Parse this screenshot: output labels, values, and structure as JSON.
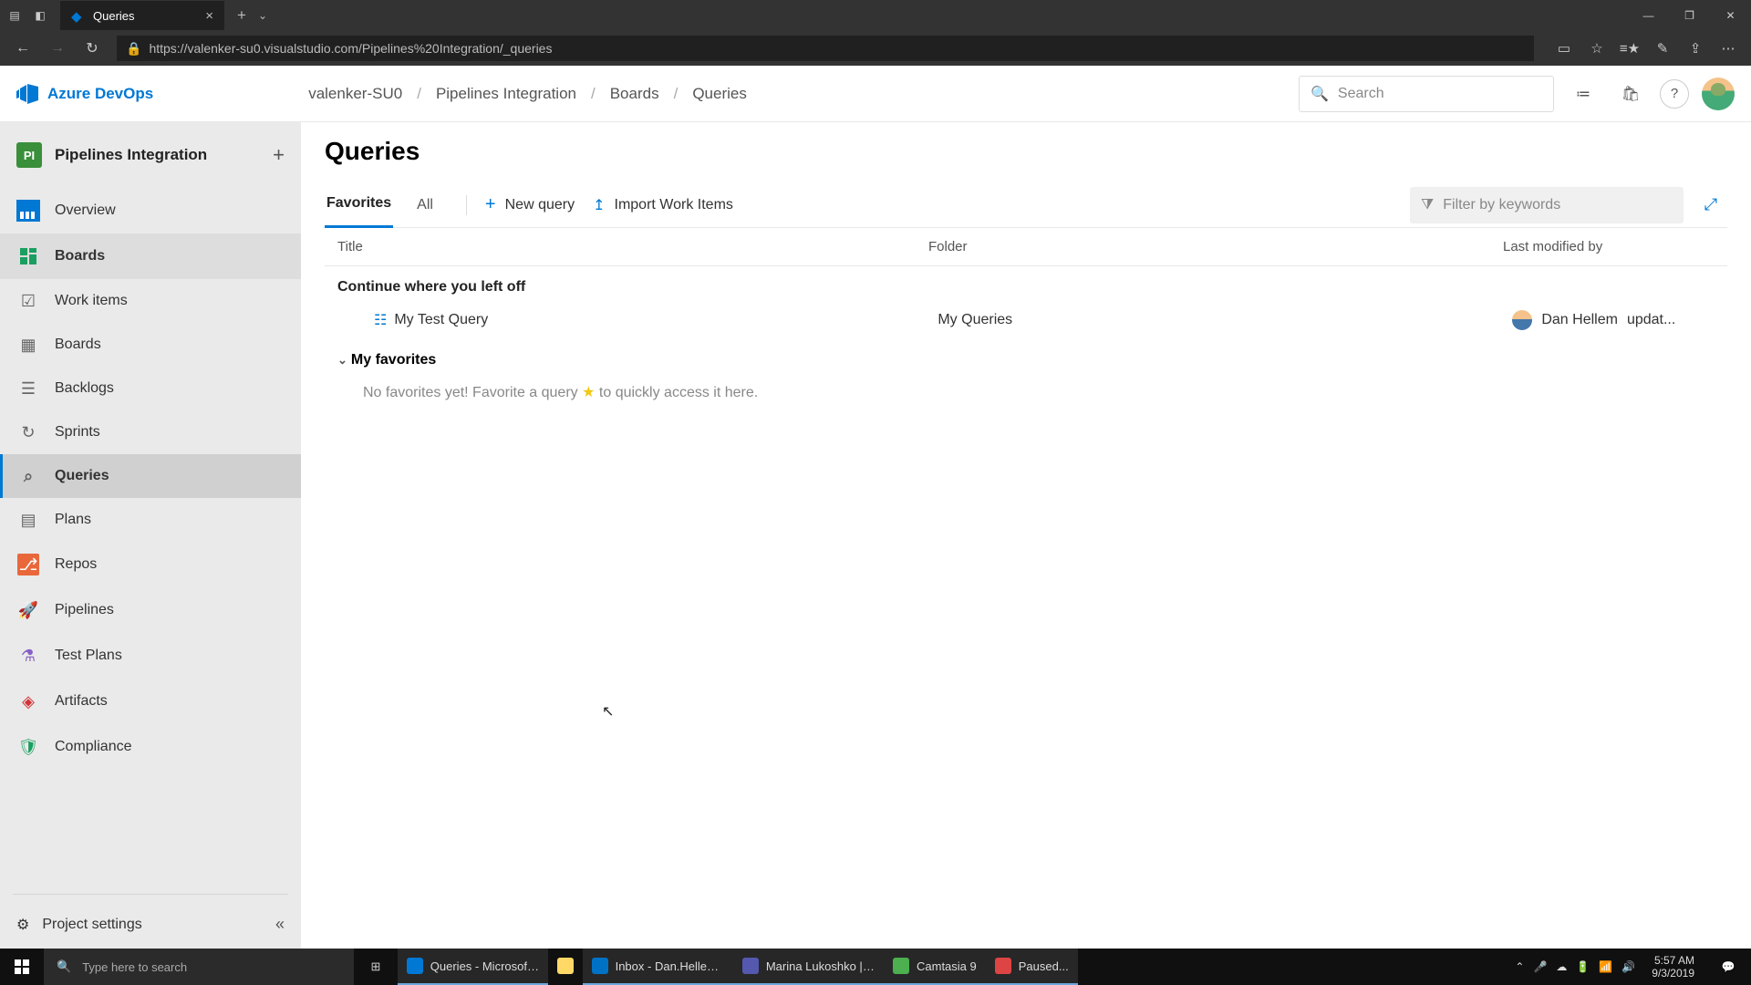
{
  "browser": {
    "tab_title": "Queries",
    "url": "https://valenker-su0.visualstudio.com/Pipelines%20Integration/_queries"
  },
  "header": {
    "logo": "Azure DevOps",
    "breadcrumbs": [
      "valenker-SU0",
      "Pipelines Integration",
      "Boards",
      "Queries"
    ],
    "search_placeholder": "Search"
  },
  "sidebar": {
    "project_badge": "PI",
    "project_name": "Pipelines Integration",
    "overview": "Overview",
    "boards": "Boards",
    "work_items": "Work items",
    "boards_sub": "Boards",
    "backlogs": "Backlogs",
    "sprints": "Sprints",
    "queries": "Queries",
    "plans": "Plans",
    "repos": "Repos",
    "pipelines": "Pipelines",
    "test_plans": "Test Plans",
    "artifacts": "Artifacts",
    "compliance": "Compliance",
    "project_settings": "Project settings"
  },
  "main": {
    "title": "Queries",
    "tab_favorites": "Favorites",
    "tab_all": "All",
    "new_query": "New query",
    "import": "Import Work Items",
    "filter_placeholder": "Filter by keywords",
    "col_title": "Title",
    "col_folder": "Folder",
    "col_modified": "Last modified by",
    "continue_section": "Continue where you left off",
    "query_row": {
      "title": "My Test Query",
      "folder": "My Queries",
      "modified_by": "Dan Hellem",
      "modified_suffix": "updat..."
    },
    "favorites_section": "My favorites",
    "empty_pre": "No favorites yet! Favorite a query ",
    "empty_post": " to quickly access it here."
  },
  "taskbar": {
    "search_placeholder": "Type here to search",
    "apps": {
      "edge": "Queries - Microsoft...",
      "outlook": "Inbox - Dan.Hellem...",
      "teams": "Marina Lukoshko | ...",
      "camtasia": "Camtasia 9",
      "paused": "Paused..."
    },
    "time": "5:57 AM",
    "date": "9/3/2019"
  }
}
